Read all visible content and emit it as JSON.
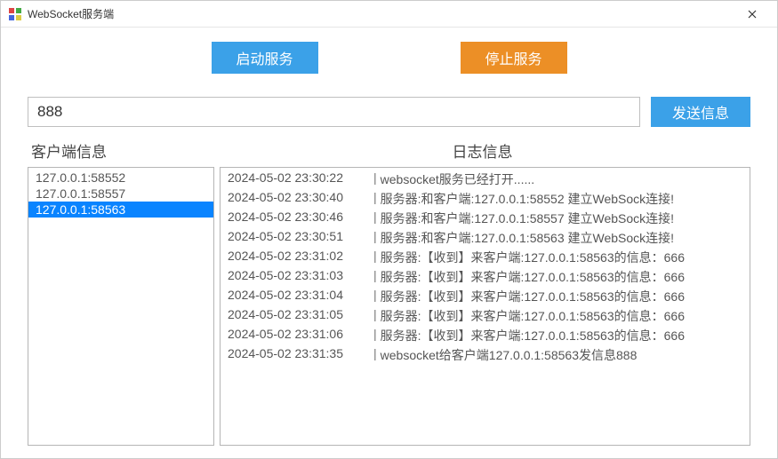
{
  "window": {
    "title": "WebSocket服务端"
  },
  "toolbar": {
    "start_label": "启动服务",
    "stop_label": "停止服务",
    "send_label": "发送信息"
  },
  "message": {
    "value": "888"
  },
  "headers": {
    "clients": "客户端信息",
    "logs": "日志信息"
  },
  "clients": [
    {
      "addr": "127.0.0.1:58552",
      "selected": false
    },
    {
      "addr": "127.0.0.1:58557",
      "selected": false
    },
    {
      "addr": "127.0.0.1:58563",
      "selected": true
    }
  ],
  "logs": [
    {
      "ts": "2024-05-02 23:30:22",
      "msg": "websocket服务已经打开......"
    },
    {
      "ts": "2024-05-02 23:30:40",
      "msg": "服务器:和客户端:127.0.0.1:58552 建立WebSock连接!"
    },
    {
      "ts": "2024-05-02 23:30:46",
      "msg": "服务器:和客户端:127.0.0.1:58557 建立WebSock连接!"
    },
    {
      "ts": "2024-05-02 23:30:51",
      "msg": "服务器:和客户端:127.0.0.1:58563 建立WebSock连接!"
    },
    {
      "ts": "2024-05-02 23:31:02",
      "msg": "服务器:【收到】来客户端:127.0.0.1:58563的信息：666"
    },
    {
      "ts": "2024-05-02 23:31:03",
      "msg": "服务器:【收到】来客户端:127.0.0.1:58563的信息：666"
    },
    {
      "ts": "2024-05-02 23:31:04",
      "msg": "服务器:【收到】来客户端:127.0.0.1:58563的信息：666"
    },
    {
      "ts": "2024-05-02 23:31:05",
      "msg": "服务器:【收到】来客户端:127.0.0.1:58563的信息：666"
    },
    {
      "ts": "2024-05-02 23:31:06",
      "msg": "服务器:【收到】来客户端:127.0.0.1:58563的信息：666"
    },
    {
      "ts": "2024-05-02 23:31:35",
      "msg": "websocket给客户端127.0.0.1:58563发信息888"
    }
  ]
}
